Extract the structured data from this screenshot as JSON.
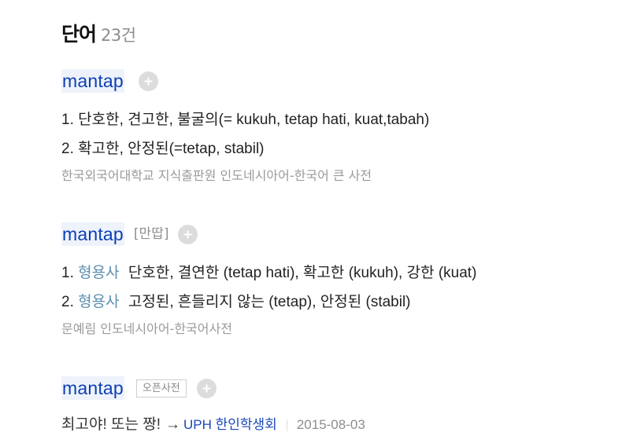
{
  "header": {
    "title": "단어",
    "count": "23건"
  },
  "entries": [
    {
      "word": "mantap",
      "definitions": [
        {
          "num": "1.",
          "text": "단호한, 견고한, 불굴의(= kukuh, tetap hati, kuat,tabah)"
        },
        {
          "num": "2.",
          "text": "확고한, 안정된(=tetap, stabil)"
        }
      ],
      "source": "한국외국어대학교 지식출판원 인도네시아어-한국어 큰 사전"
    },
    {
      "word": "mantap",
      "pronunciation": "[만땁]",
      "definitions": [
        {
          "num": "1.",
          "pos": "형용사",
          "text": "단호한, 결연한 (tetap hati), 확고한 (kukuh), 강한 (kuat)"
        },
        {
          "num": "2.",
          "pos": "형용사",
          "text": "고정된, 흔들리지 않는 (tetap), 안정된 (stabil)"
        }
      ],
      "source": "문예림 인도네시아어-한국어사전"
    },
    {
      "word": "mantap",
      "badge": "오픈사전",
      "definition": "최고야! 또는 짱!",
      "arrow": "→",
      "author": "UPH 한인학생회",
      "date": "2015-08-03"
    }
  ],
  "icons": {
    "add": "plus-circle-icon"
  },
  "colors": {
    "word_link": "#0d3fb5",
    "word_highlight": "#eef3fb",
    "pos": "#5c8fb0",
    "source": "#9a9a9a",
    "add_button": "#dcdcdc"
  }
}
